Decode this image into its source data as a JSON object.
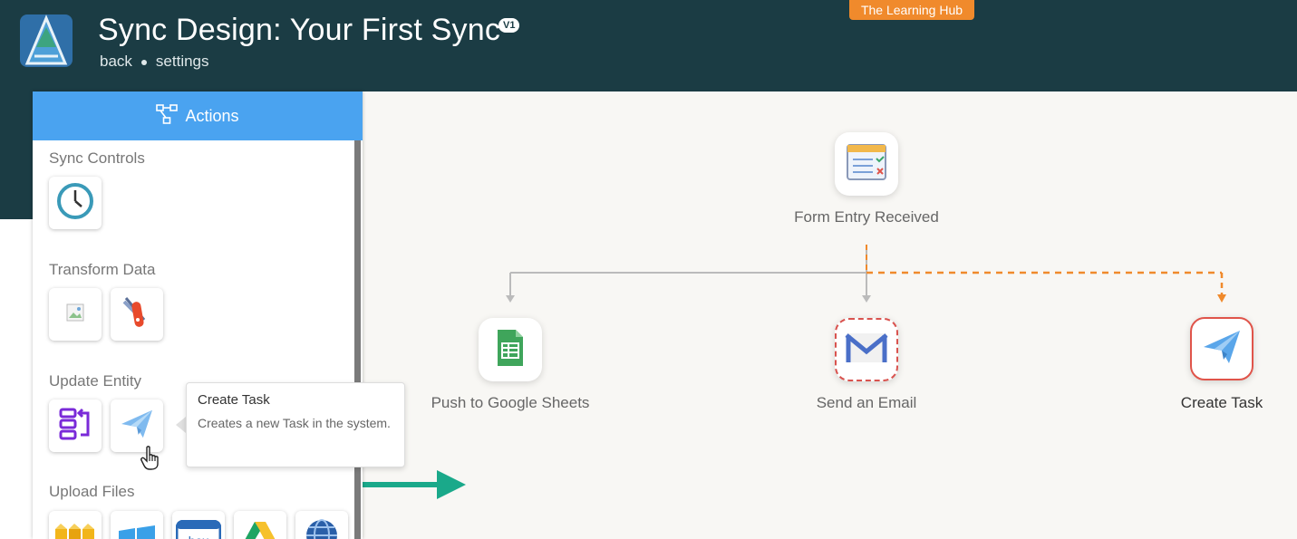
{
  "header": {
    "title": "Sync Design: Your First Sync",
    "version": "V1",
    "back_label": "back",
    "settings_label": "settings",
    "hub_badge": "The Learning Hub"
  },
  "panel": {
    "title": "Actions",
    "sections": {
      "sync_controls": "Sync Controls",
      "transform_data": "Transform Data",
      "update_entity": "Update Entity",
      "upload_files": "Upload Files"
    }
  },
  "tooltip": {
    "title": "Create Task",
    "description": "Creates a new Task in the system."
  },
  "flow": {
    "trigger": "Form Entry Received",
    "nodes": {
      "sheets": "Push to Google Sheets",
      "email": "Send an Email",
      "task": "Create Task"
    }
  },
  "colors": {
    "header_bg": "#1b3c44",
    "accent": "#4aa3f0",
    "hub_orange": "#f08a2c",
    "selected_red": "#e0544a",
    "arrow_green": "#1aa98a"
  },
  "icons": [
    "logo-icon",
    "share-nodes-icon",
    "clock-icon",
    "broken-image-icon",
    "swiss-knife-icon",
    "workflow-icon",
    "paper-plane-icon",
    "hand-pointer-icon",
    "amazon-s3-icon",
    "windows-azure-icon",
    "box-icon",
    "google-drive-icon",
    "globe-icon",
    "form-icon",
    "google-sheets-icon",
    "gmail-icon"
  ]
}
